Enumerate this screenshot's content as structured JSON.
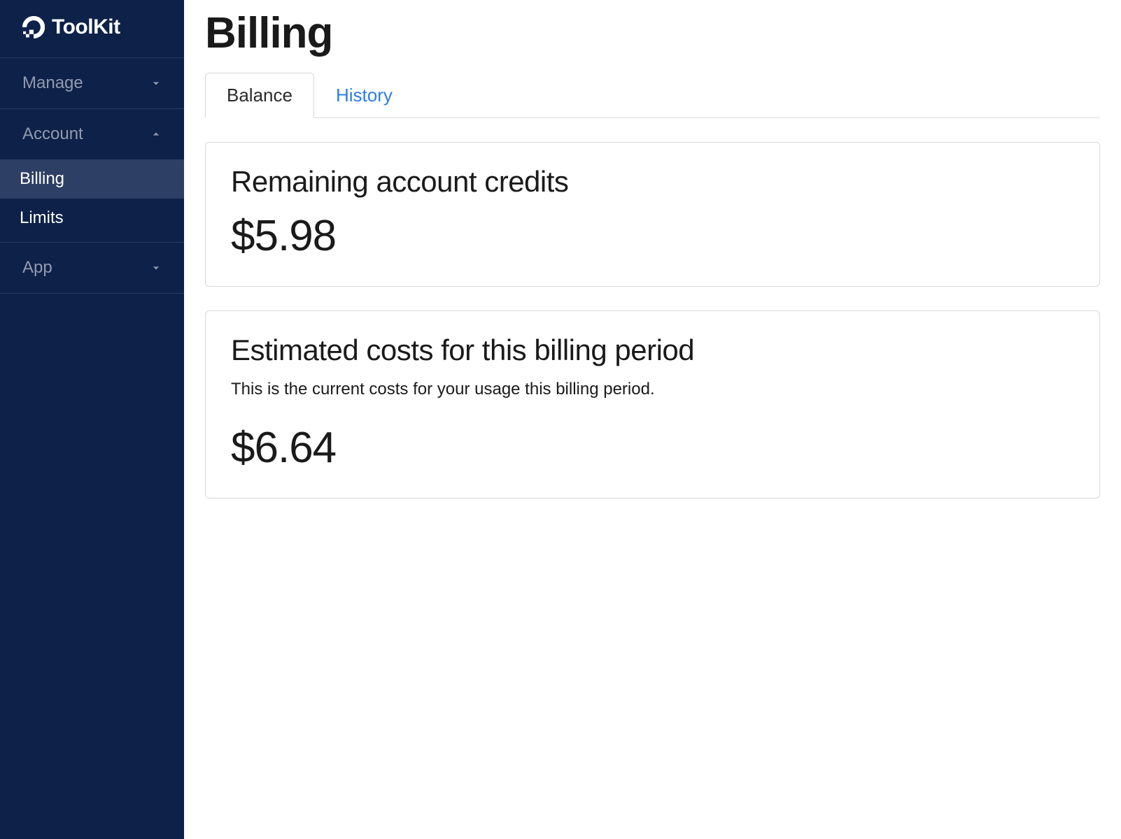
{
  "brand": {
    "name": "ToolKit"
  },
  "sidebar": {
    "sections": [
      {
        "label": "Manage",
        "expanded": false
      },
      {
        "label": "Account",
        "expanded": true
      },
      {
        "label": "App",
        "expanded": false
      }
    ],
    "account_items": [
      {
        "label": "Billing",
        "active": true
      },
      {
        "label": "Limits",
        "active": false
      }
    ]
  },
  "page": {
    "title": "Billing"
  },
  "tabs": [
    {
      "label": "Balance",
      "active": true
    },
    {
      "label": "History",
      "active": false
    }
  ],
  "cards": {
    "credits": {
      "title": "Remaining account credits",
      "value": "$5.98"
    },
    "estimate": {
      "title": "Estimated costs for this billing period",
      "subtitle": "This is the current costs for your usage this billing period.",
      "value": "$6.64"
    }
  }
}
